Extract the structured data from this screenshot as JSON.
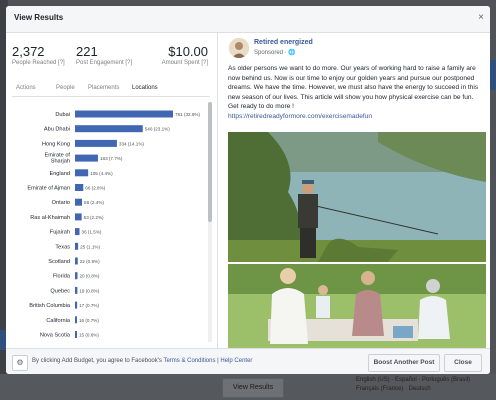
{
  "modal": {
    "title": "View Results",
    "close_icon": "×"
  },
  "stats": [
    {
      "value": "2,372",
      "label": "People Reached"
    },
    {
      "value": "221",
      "label": "Post Engagement"
    },
    {
      "value": "$10.00",
      "label": "Amount Spent"
    }
  ],
  "tabs": [
    "Actions",
    "People",
    "Placements",
    "Locations"
  ],
  "active_tab": "Locations",
  "chart_data": {
    "type": "bar",
    "orientation": "horizontal",
    "color": "#4267b2",
    "categories": [
      "Dubai",
      "Abu Dhabi",
      "Hong Kong",
      "Emirate of Sharjah",
      "England",
      "Emirate of Ajman",
      "Ontario",
      "Ras al-Khaimah",
      "Fujairah",
      "Texas",
      "Scotland",
      "Florida",
      "Quebec",
      "British Columbia",
      "California",
      "Nova Scotia"
    ],
    "values": [
      781,
      540,
      334,
      183,
      105,
      66,
      56,
      53,
      36,
      25,
      22,
      20,
      19,
      17,
      16,
      15
    ],
    "data_labels": [
      "781 (32.9%)",
      "540 (23.1%)",
      "334 (14.1%)",
      "183 (7.7%)",
      "105 (4.4%)",
      "66 (2.8%)",
      "56 (2.4%)",
      "53 (2.2%)",
      "36 (1.5%)",
      "25 (1.1%)",
      "22 (0.9%)",
      "20 (0.8%)",
      "19 (0.8%)",
      "17 (0.7%)",
      "16 (0.7%)",
      "15 (0.6%)"
    ]
  },
  "post": {
    "author": "Retired energized",
    "sponsored": "Sponsored · ",
    "text": "As older persons we want to do more. Our years of working hard to raise a family are now behind us. Now is our time to enjoy our golden years and pursue our postponed dreams. We have the time. However, we must also have the energy to succeed in this new season of our lives. This article will show you how physical exercise can be fun. Get ready to do more !",
    "link": "https://retiredreadyformore.com/exercisemadefun"
  },
  "footer": {
    "prefix": "By clicking Add Budget, you agree to Facebook's ",
    "terms": "Terms & Conditions",
    "sep": " | ",
    "help": "Help Center",
    "boost_button": "Boost Another Post",
    "close_button": "Close"
  },
  "background": {
    "view_results_button": "View Results",
    "languages_line1": "English (US) · Español · Português (Brasil)",
    "languages_line2": "Français (France) · Deutsch"
  }
}
